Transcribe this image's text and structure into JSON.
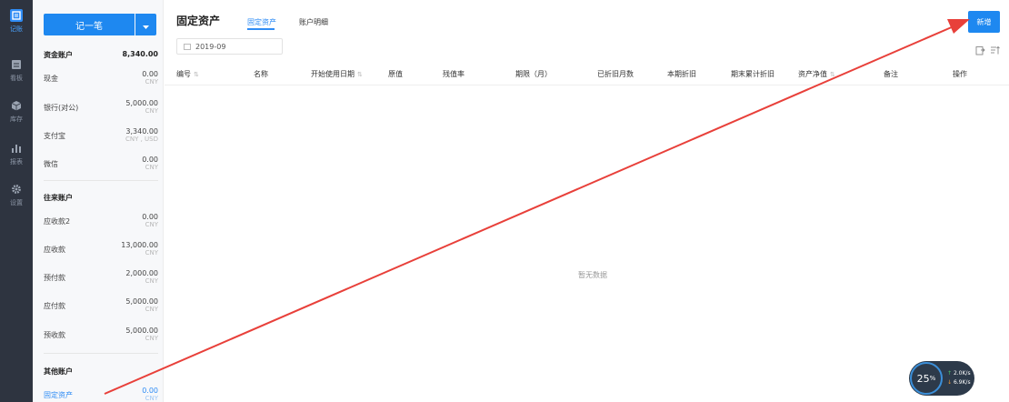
{
  "nav": [
    {
      "label": "记账",
      "icon": "ledger-icon"
    },
    {
      "label": "看板",
      "icon": "dashboard-icon"
    },
    {
      "label": "库存",
      "icon": "inventory-icon"
    },
    {
      "label": "报表",
      "icon": "report-icon"
    },
    {
      "label": "设置",
      "icon": "gear-icon"
    }
  ],
  "accounts": {
    "record_label": "记一笔",
    "fund_group": {
      "label": "资金账户",
      "total": "8,340.00"
    },
    "fund": [
      {
        "name": "现金",
        "amount": "0.00",
        "currency": "CNY"
      },
      {
        "name": "银行(对公)",
        "amount": "5,000.00",
        "currency": "CNY"
      },
      {
        "name": "支付宝",
        "amount": "3,340.00",
        "currency": "CNY , USD"
      },
      {
        "name": "微信",
        "amount": "0.00",
        "currency": "CNY"
      }
    ],
    "ar_group": {
      "label": "往来账户"
    },
    "ar": [
      {
        "name": "应收款2",
        "amount": "0.00",
        "currency": "CNY"
      },
      {
        "name": "应收款",
        "amount": "13,000.00",
        "currency": "CNY"
      },
      {
        "name": "预付款",
        "amount": "2,000.00",
        "currency": "CNY"
      },
      {
        "name": "应付款",
        "amount": "5,000.00",
        "currency": "CNY"
      },
      {
        "name": "预收款",
        "amount": "5,000.00",
        "currency": "CNY"
      }
    ],
    "other_group": {
      "label": "其他账户"
    },
    "other": [
      {
        "name": "固定资产",
        "amount": "0.00",
        "currency": "CNY"
      }
    ]
  },
  "main": {
    "title": "固定资产",
    "tabs": [
      "固定资产",
      "账户明细"
    ],
    "add_label": "新增",
    "date": "2019-09",
    "columns": [
      "编号",
      "名称",
      "开始使用日期",
      "原值",
      "残值率",
      "期限（月）",
      "已折旧月数",
      "本期折旧",
      "期末累计折旧",
      "资产净值",
      "备注",
      "操作"
    ],
    "empty_text": "暂无数据"
  },
  "speed": {
    "percent": "25",
    "percent_unit": "%",
    "up": "2.0K/s",
    "down": "6.9K/s"
  },
  "colors": {
    "accent": "#1e88f0",
    "rail": "#2e3440",
    "annotation_arrow": "#e8403a"
  }
}
